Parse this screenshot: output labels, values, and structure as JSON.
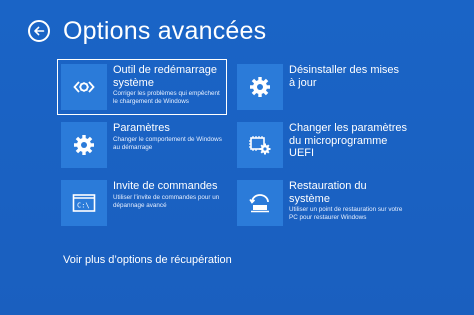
{
  "header": {
    "title": "Options avancées",
    "back_icon": "arrow-left-icon"
  },
  "tiles": [
    {
      "title": "Outil de redémarrage système",
      "desc": "Corriger les problèmes qui empêchent le chargement de Windows",
      "icon": "startup-repair-icon",
      "selected": true
    },
    {
      "title": "Désinstaller des mises à jour",
      "desc": "",
      "icon": "gear-icon"
    },
    {
      "title": "Paramètres",
      "desc": "Changer le comportement de Windows au démarrage",
      "icon": "gear-icon"
    },
    {
      "title": "Changer les paramètres du microprogramme UEFI",
      "desc": "",
      "icon": "uefi-chip-gear-icon"
    },
    {
      "title": "Invite de commandes",
      "desc": "Utiliser l'invite de commandes pour un dépannage avancé",
      "icon": "command-prompt-icon"
    },
    {
      "title": "Restauration du système",
      "desc": "Utiliser un point de restauration sur votre PC pour restaurer Windows",
      "icon": "system-restore-icon"
    }
  ],
  "footer": {
    "more_options": "Voir plus d’options de récupération"
  },
  "colors": {
    "background": "#1a64c6",
    "tile_icon_bg": "#2b7bd9",
    "text": "#ffffff"
  }
}
